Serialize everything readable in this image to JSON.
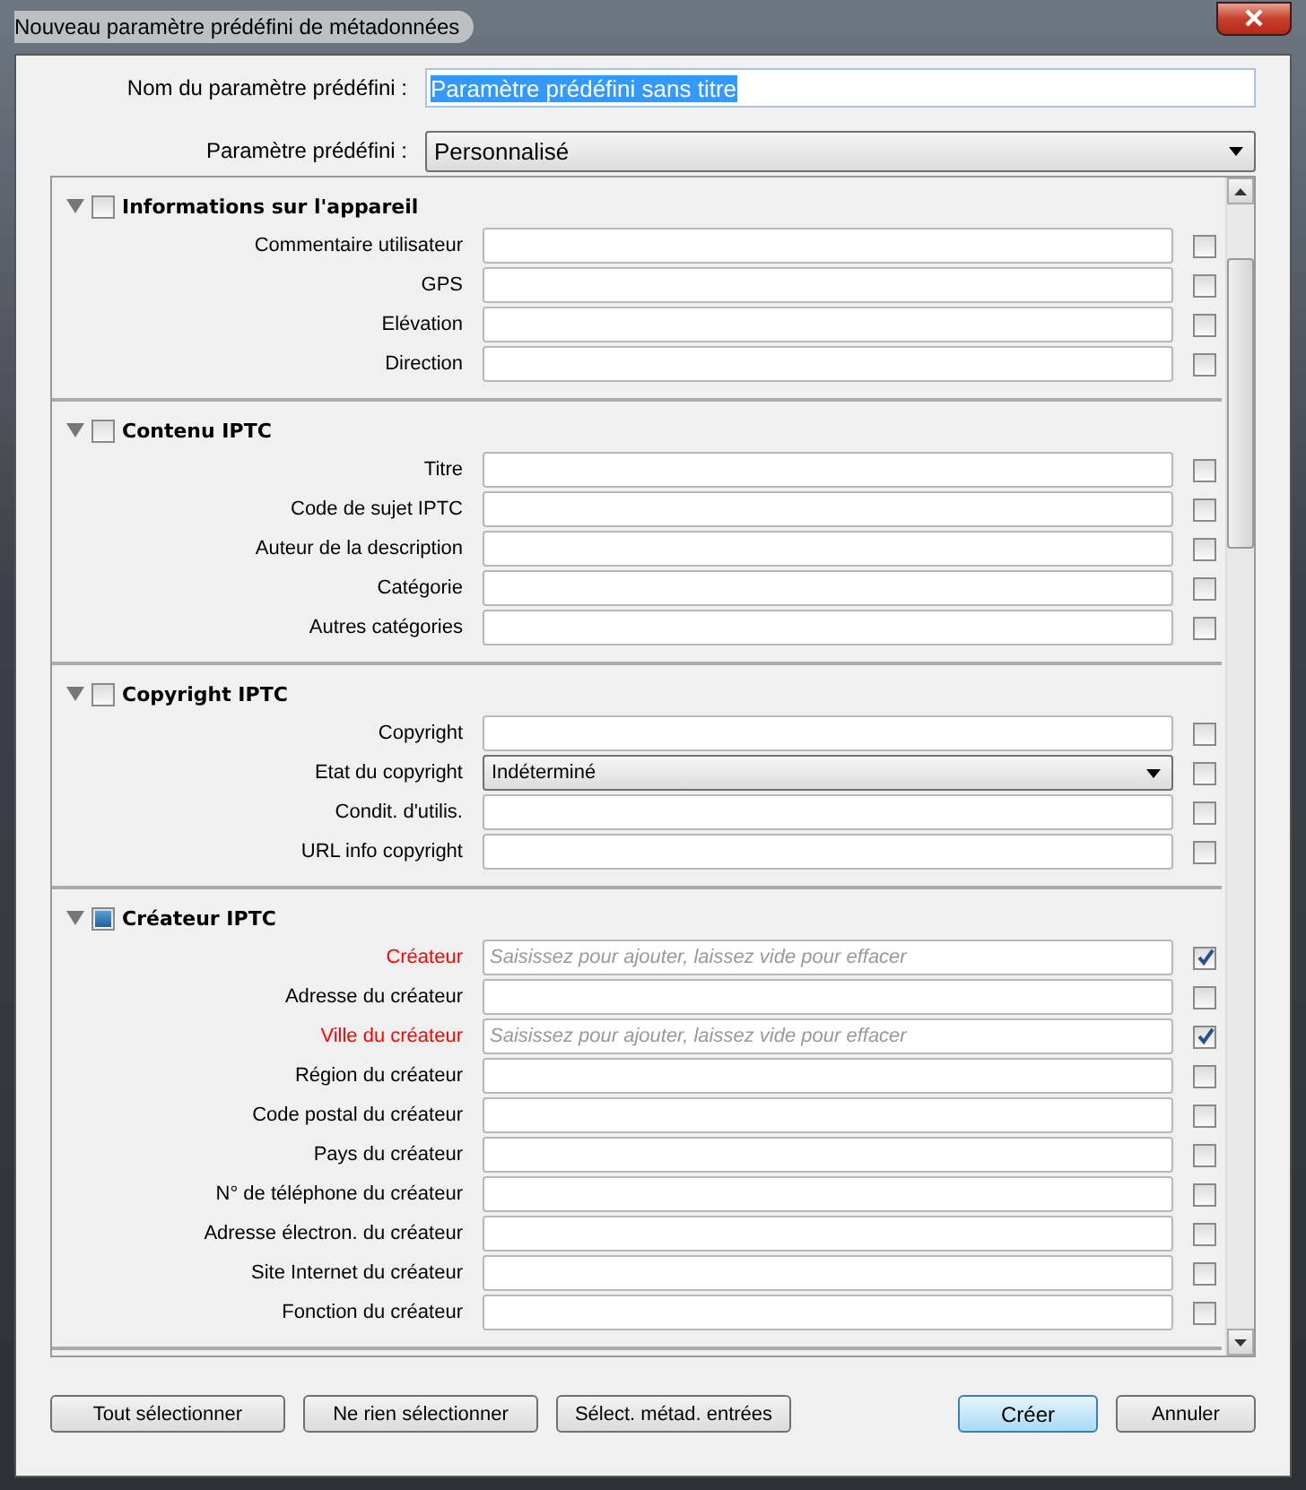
{
  "window": {
    "title": "Nouveau paramètre prédéfini de métadonnées"
  },
  "preset_name": {
    "label": "Nom du paramètre prédéfini :",
    "value": "Paramètre prédéfini sans titre"
  },
  "preset": {
    "label": "Paramètre prédéfini :",
    "value": "Personnalisé"
  },
  "sections": [
    {
      "title": "Informations sur l'appareil",
      "expanded": true,
      "checked": false,
      "fields": [
        {
          "label": "Commentaire utilisateur",
          "kind": "text",
          "required": false,
          "checked": false
        },
        {
          "label": "GPS",
          "kind": "text",
          "required": false,
          "checked": false
        },
        {
          "label": "Elévation",
          "kind": "text",
          "required": false,
          "checked": false
        },
        {
          "label": "Direction",
          "kind": "text",
          "required": false,
          "checked": false
        }
      ]
    },
    {
      "title": "Contenu IPTC",
      "expanded": true,
      "checked": false,
      "fields": [
        {
          "label": "Titre",
          "kind": "text",
          "required": false,
          "checked": false
        },
        {
          "label": "Code de sujet IPTC",
          "kind": "text",
          "required": false,
          "checked": false
        },
        {
          "label": "Auteur de la description",
          "kind": "text",
          "required": false,
          "checked": false
        },
        {
          "label": "Catégorie",
          "kind": "text",
          "required": false,
          "checked": false
        },
        {
          "label": "Autres catégories",
          "kind": "text",
          "required": false,
          "checked": false
        }
      ]
    },
    {
      "title": "Copyright IPTC",
      "expanded": true,
      "checked": false,
      "fields": [
        {
          "label": "Copyright",
          "kind": "text",
          "required": false,
          "checked": false
        },
        {
          "label": "Etat du copyright",
          "kind": "select",
          "value": "Indéterminé",
          "required": false,
          "checked": false
        },
        {
          "label": "Condit. d'utilis.",
          "kind": "text",
          "required": false,
          "checked": false
        },
        {
          "label": "URL info copyright",
          "kind": "text",
          "required": false,
          "checked": false
        }
      ]
    },
    {
      "title": "Créateur IPTC",
      "expanded": true,
      "checked": true,
      "fields": [
        {
          "label": "Créateur",
          "kind": "text",
          "placeholder": "Saisissez pour ajouter, laissez vide pour effacer",
          "required": true,
          "checked": true
        },
        {
          "label": "Adresse du créateur",
          "kind": "text",
          "required": false,
          "checked": false
        },
        {
          "label": "Ville du créateur",
          "kind": "text",
          "placeholder": "Saisissez pour ajouter, laissez vide pour effacer",
          "required": true,
          "checked": true
        },
        {
          "label": "Région du créateur",
          "kind": "text",
          "required": false,
          "checked": false
        },
        {
          "label": "Code postal du créateur",
          "kind": "text",
          "required": false,
          "checked": false
        },
        {
          "label": "Pays du créateur",
          "kind": "text",
          "required": false,
          "checked": false
        },
        {
          "label": "N° de téléphone du créateur",
          "kind": "text",
          "required": false,
          "checked": false
        },
        {
          "label": "Adresse électron. du créateur",
          "kind": "text",
          "required": false,
          "checked": false
        },
        {
          "label": "Site Internet du créateur",
          "kind": "text",
          "required": false,
          "checked": false
        },
        {
          "label": "Fonction du créateur",
          "kind": "text",
          "required": false,
          "checked": false
        }
      ]
    }
  ],
  "buttons_left": [
    "Tout sélectionner",
    "Ne rien sélectionner",
    "Sélect. métad. entrées"
  ],
  "buttons_right": [
    {
      "label": "Créer",
      "default": true
    },
    {
      "label": "Annuler",
      "default": false
    }
  ]
}
